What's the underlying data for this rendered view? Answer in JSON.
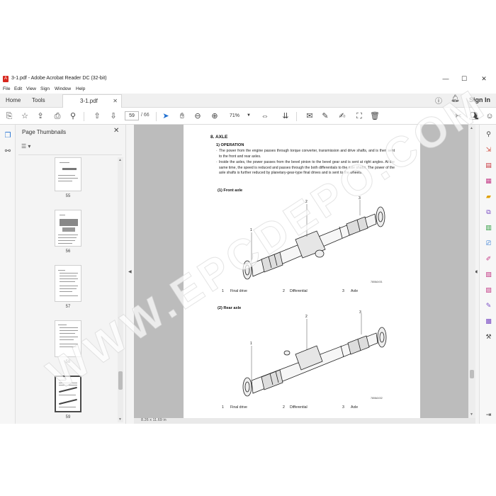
{
  "window": {
    "title": "3-1.pdf - Adobe Acrobat Reader DC (32-bit)",
    "minimize": "—",
    "maximize": "☐",
    "close": "✕"
  },
  "menu": [
    "File",
    "Edit",
    "View",
    "Sign",
    "Window",
    "Help"
  ],
  "tabs": {
    "home": "Home",
    "tools": "Tools",
    "document": "3-1.pdf",
    "sign_in": "Sign In"
  },
  "toolbar": {
    "page_current": "59",
    "page_total": "/ 66",
    "zoom": "71%"
  },
  "thumbnail_panel": {
    "title": "Page Thumbnails",
    "pages": [
      "55",
      "56",
      "57",
      "58",
      "59"
    ],
    "selected_page": "59"
  },
  "status": {
    "page_size": "8.26 x 11.69 in"
  },
  "document": {
    "section_title": "8. AXLE",
    "sub_operation": "1) OPERATION",
    "para1": "The power from the engine passes through torque converter, transmission and drive shafts, and is then sent to the front and rear axles.",
    "para2": "Inside the axles, the power passes from the bevel pinion to the bevel gear and is sent at right angles. At the same time, the speed is reduced and passes through the both differentials to the axle shafts. The power of the axle shafts is further reduced by planetary-gear-type final drives and is sent to the wheels.",
    "front_axle_heading": "(1) Front axle",
    "rear_axle_heading": "(2) Rear axle",
    "front_fig_code": "7808AX01",
    "rear_fig_code": "7808AX02",
    "callouts": [
      "1",
      "2",
      "3"
    ],
    "legend": [
      {
        "num": "1",
        "label": "Final drive"
      },
      {
        "num": "2",
        "label": "Differential"
      },
      {
        "num": "3",
        "label": "Axle"
      }
    ]
  },
  "watermark": "WWW.EPCDEPO.COM",
  "icons": {
    "app": "acrobat-icon",
    "colors": {
      "acrobat_red": "#d8281f",
      "accent_blue": "#1f6fd1"
    }
  }
}
